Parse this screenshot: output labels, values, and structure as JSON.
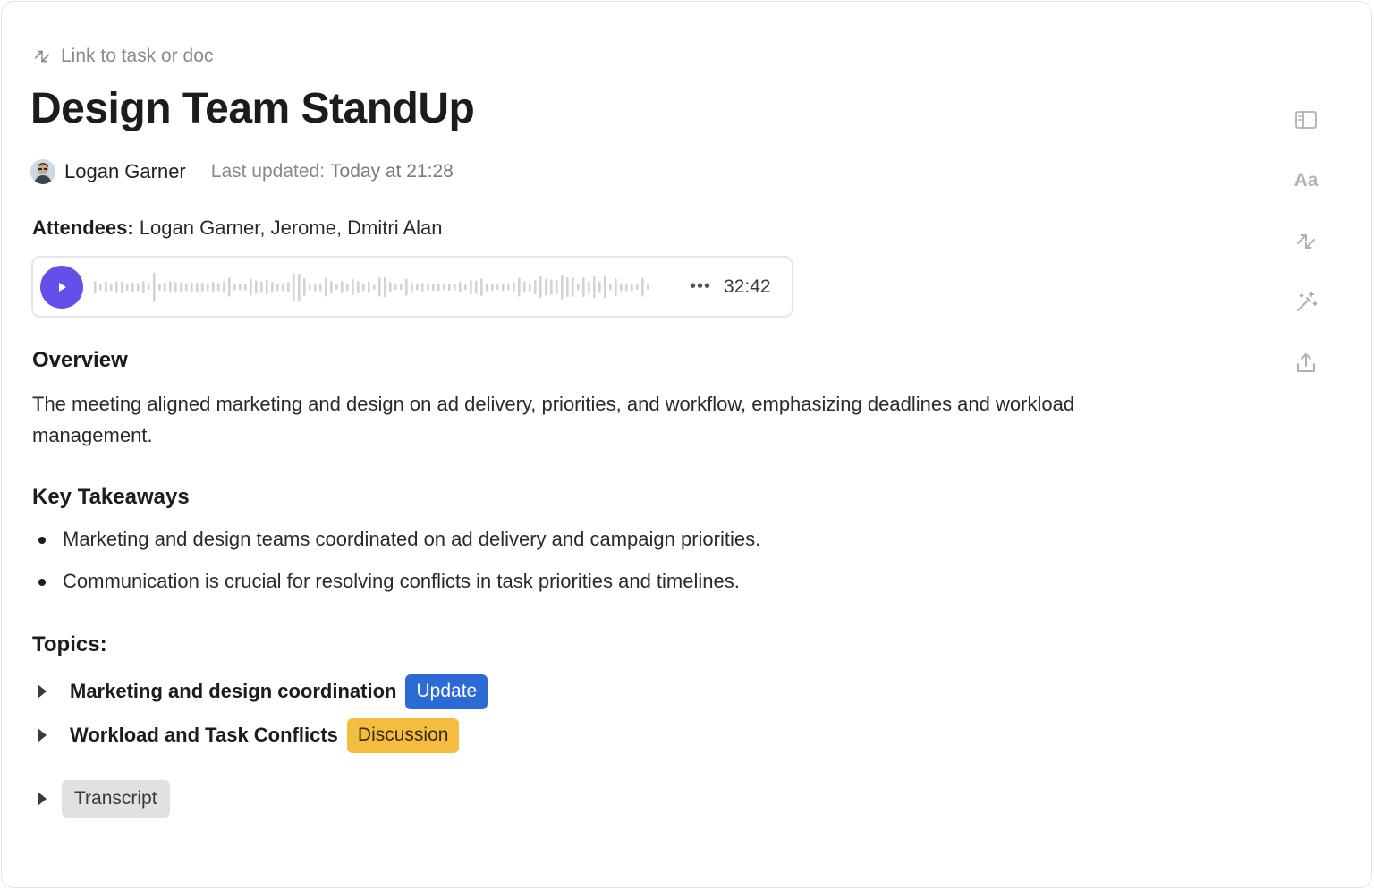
{
  "link": {
    "label": "Link to task or doc",
    "icon": "link-arrows-icon"
  },
  "doc": {
    "title": "Design Team StandUp",
    "author": "Logan Garner",
    "last_updated_label": "Last updated:",
    "last_updated_value": "Today at 21:28"
  },
  "attendees": {
    "label": "Attendees:",
    "names": "Logan Garner, Jerome, Dmitri Alan"
  },
  "audio": {
    "duration": "32:42",
    "more_label": "•••",
    "accent_color": "#6151e8"
  },
  "overview": {
    "heading": "Overview",
    "text": "The meeting aligned marketing and design on ad delivery, priorities, and workflow, emphasizing deadlines and workload management."
  },
  "takeaways": {
    "heading": "Key Takeaways",
    "items": [
      "Marketing and design teams coordinated on ad delivery and campaign priorities.",
      "Communication is crucial for resolving conflicts in task priorities and timelines."
    ]
  },
  "topics": {
    "heading": "Topics:",
    "items": [
      {
        "title": "Marketing and design coordination",
        "tag": "Update",
        "tag_color": "#2c6bd6"
      },
      {
        "title": "Workload and Task Conflicts",
        "tag": "Discussion",
        "tag_color": "#f4bd3f"
      }
    ]
  },
  "transcript": {
    "label": "Transcript"
  },
  "toolbar": {
    "items": [
      {
        "icon": "sidebar-panel-icon"
      },
      {
        "icon": "text-format-icon",
        "label": "Aa"
      },
      {
        "icon": "link-arrows-icon"
      },
      {
        "icon": "magic-wand-icon"
      },
      {
        "icon": "share-upload-icon"
      }
    ]
  }
}
